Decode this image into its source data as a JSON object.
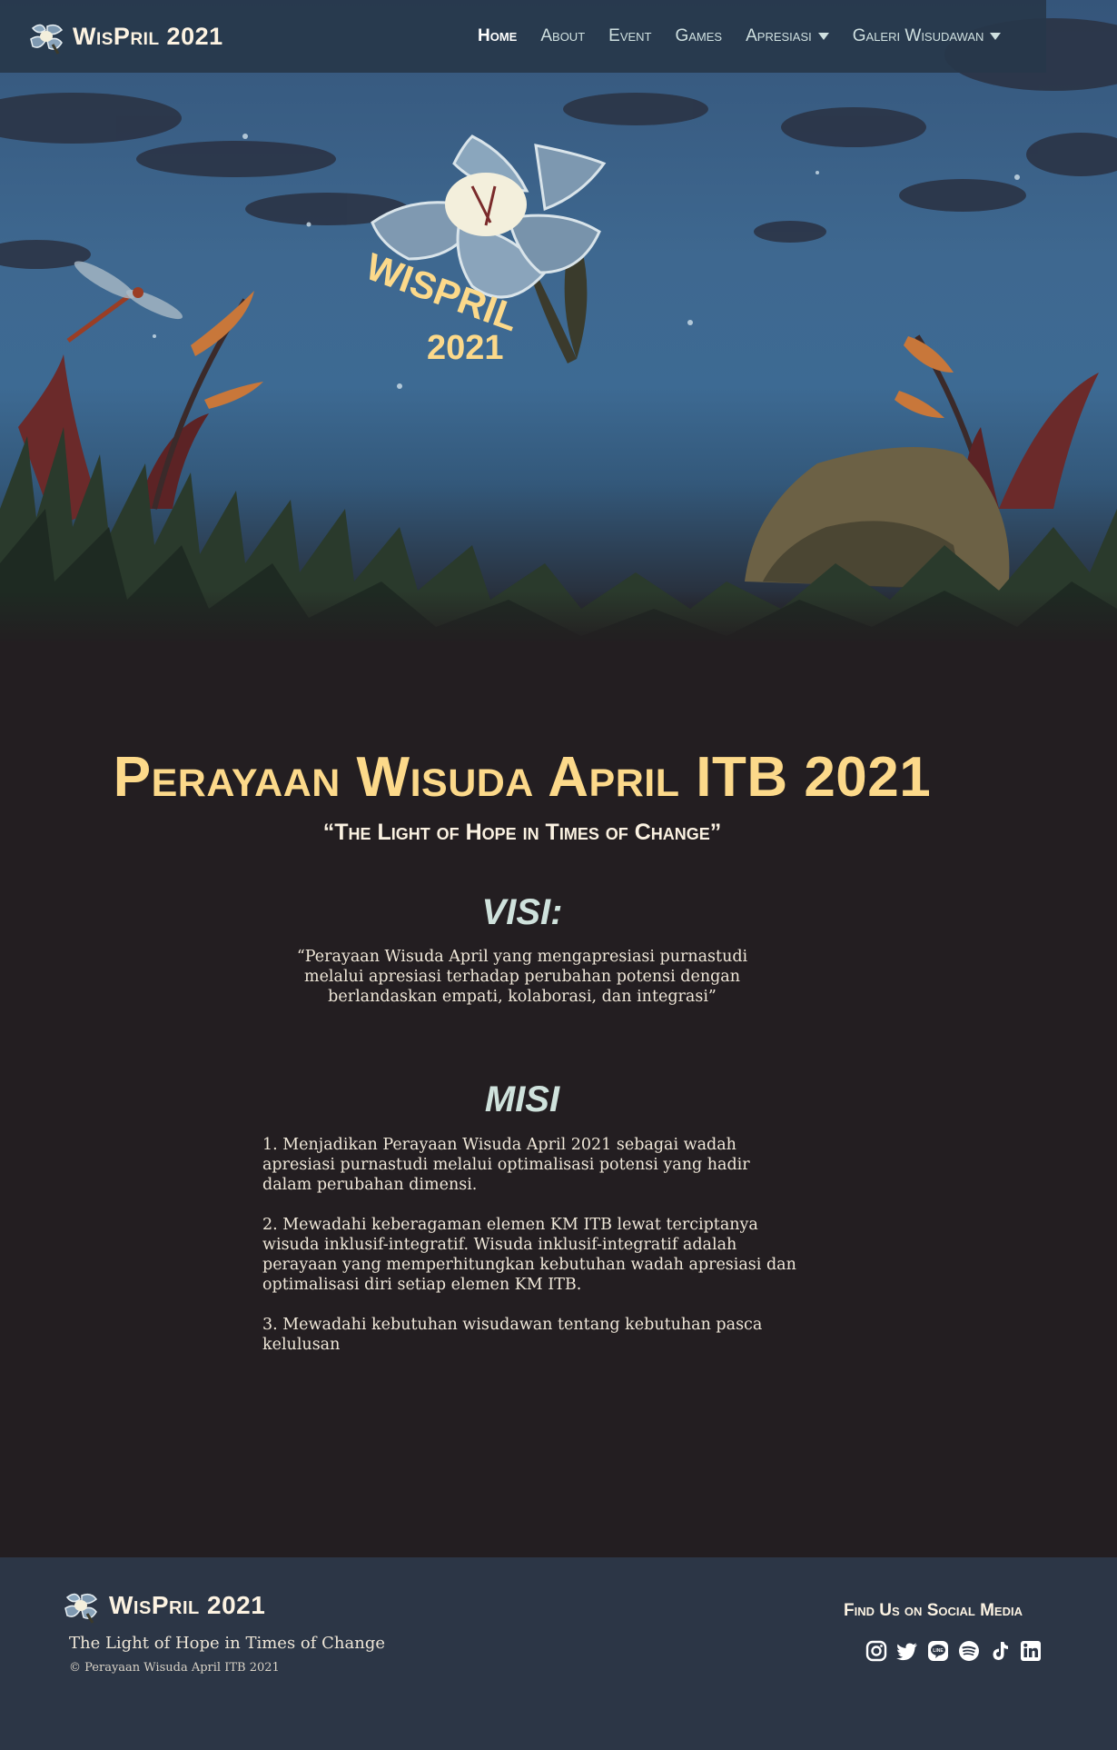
{
  "brand": {
    "name": "WisPril 2021"
  },
  "nav": {
    "items": [
      {
        "label": "Home",
        "active": true
      },
      {
        "label": "About"
      },
      {
        "label": "Event"
      },
      {
        "label": "Games"
      },
      {
        "label": "Apresiasi",
        "dropdown": true
      },
      {
        "label": "Galeri Wisudawan",
        "dropdown": true
      }
    ]
  },
  "hero": {
    "logo_text_line1": "WISPRIL",
    "logo_text_line2": "2021"
  },
  "main": {
    "title": "Perayaan Wisuda April ITB 2021",
    "tagline": "“The Light of Hope in Times of Change”",
    "visi_heading": "VISI:",
    "visi_text": "“Perayaan Wisuda April yang mengapresiasi purnastudi melalui apresiasi terhadap perubahan potensi dengan berlandaskan empati, kolaborasi, dan integrasi”",
    "misi_heading": "MISI",
    "misi_items": [
      "1. Menjadikan Perayaan Wisuda April 2021 sebagai wadah apresiasi purnastudi melalui optimalisasi potensi yang hadir dalam perubahan dimensi.",
      "2. Mewadahi keberagaman elemen KM ITB lewat terciptanya wisuda inklusif-integratif. Wisuda inklusif-integratif adalah perayaan yang memperhitungkan kebutuhan wadah apresiasi dan optimalisasi diri setiap elemen KM ITB.",
      "3. Mewadahi kebutuhan wisudawan tentang kebutuhan pasca kelulusan"
    ]
  },
  "footer": {
    "brand": "WisPril 2021",
    "tagline": "The Light of Hope in Times of Change",
    "copyright": "© Perayaan Wisuda April ITB 2021",
    "social_title": "Find Us on Social Media",
    "social_icons": [
      "instagram-icon",
      "twitter-icon",
      "line-icon",
      "spotify-icon",
      "tiktok-icon",
      "linkedin-icon"
    ]
  },
  "colors": {
    "title_yellow": "#fcd98a",
    "heading_mint": "#cfe2dc",
    "nav_bg": "#27374a",
    "footer_bg": "#2c3646",
    "page_bg": "#231e21"
  }
}
